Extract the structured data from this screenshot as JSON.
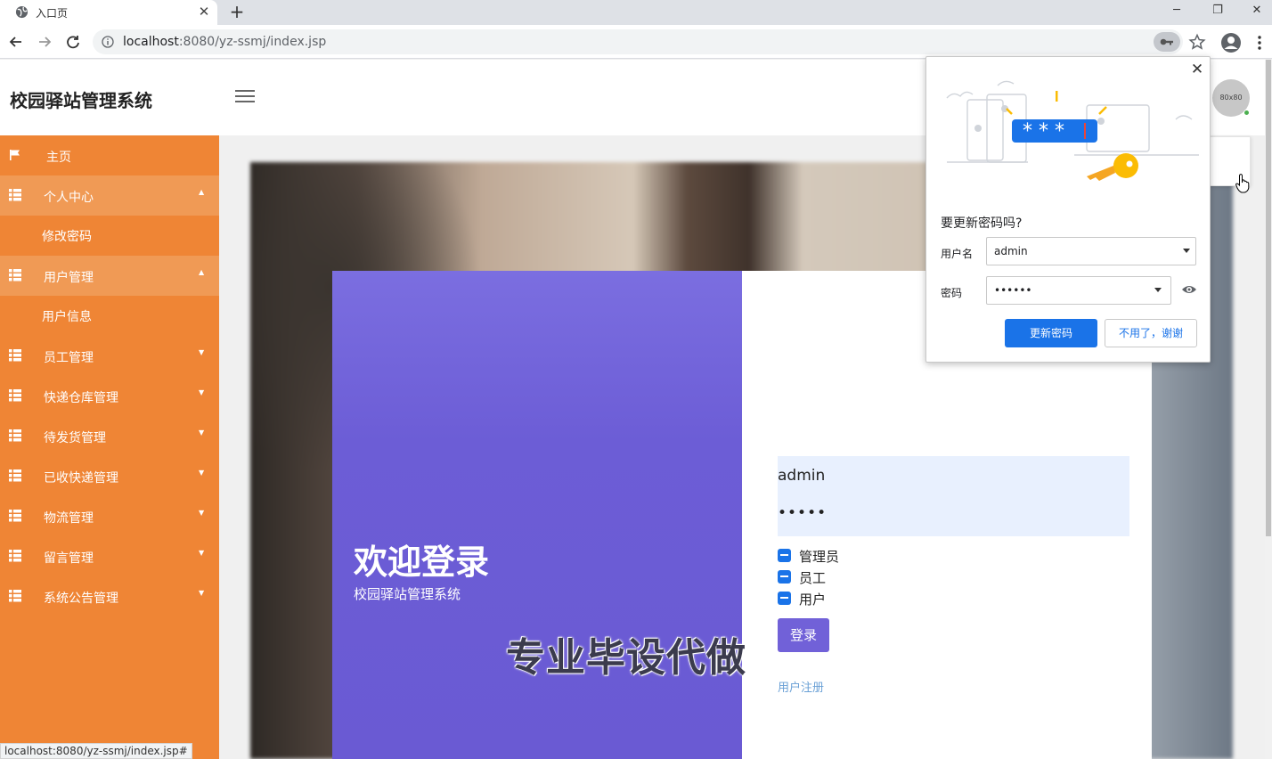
{
  "browser": {
    "tab_title": "入口页",
    "url_host": "localhost",
    "url_rest": ":8080/yz-ssmj/index.jsp",
    "status_url": "localhost:8080/yz-ssmj/index.jsp#"
  },
  "header": {
    "app_title": "校园驿站管理系统",
    "avatar_text": "80x80"
  },
  "sidebar": {
    "items": [
      {
        "label": "主页",
        "icon": "flag-icon"
      },
      {
        "label": "个人中心",
        "icon": "grid-icon",
        "expanded": true,
        "children": [
          "修改密码"
        ]
      },
      {
        "label": "用户管理",
        "icon": "grid-icon",
        "expanded": true,
        "children": [
          "用户信息"
        ]
      },
      {
        "label": "员工管理",
        "icon": "grid-icon"
      },
      {
        "label": "快递仓库管理",
        "icon": "grid-icon"
      },
      {
        "label": "待发货管理",
        "icon": "grid-icon"
      },
      {
        "label": "已收快递管理",
        "icon": "grid-icon"
      },
      {
        "label": "物流管理",
        "icon": "grid-icon"
      },
      {
        "label": "留言管理",
        "icon": "grid-icon"
      },
      {
        "label": "系统公告管理",
        "icon": "grid-icon"
      }
    ]
  },
  "login": {
    "welcome": "欢迎登录",
    "subtitle": "校园驿站管理系统",
    "username_value": "admin",
    "password_value": "•••••",
    "roles": [
      "管理员",
      "员工",
      "用户"
    ],
    "login_button": "登录",
    "register_link": "用户注册",
    "watermark": "专业毕设代做"
  },
  "password_popup": {
    "question": "要更新密码吗?",
    "username_label": "用户名",
    "username_value": "admin",
    "password_label": "密码",
    "password_value": "••••••",
    "update_button": "更新密码",
    "decline_button": "不用了，谢谢",
    "accent_color": "#1a73e8"
  },
  "colors": {
    "sidebar": "#ef8535",
    "login_panel": "#6c5dd6"
  }
}
